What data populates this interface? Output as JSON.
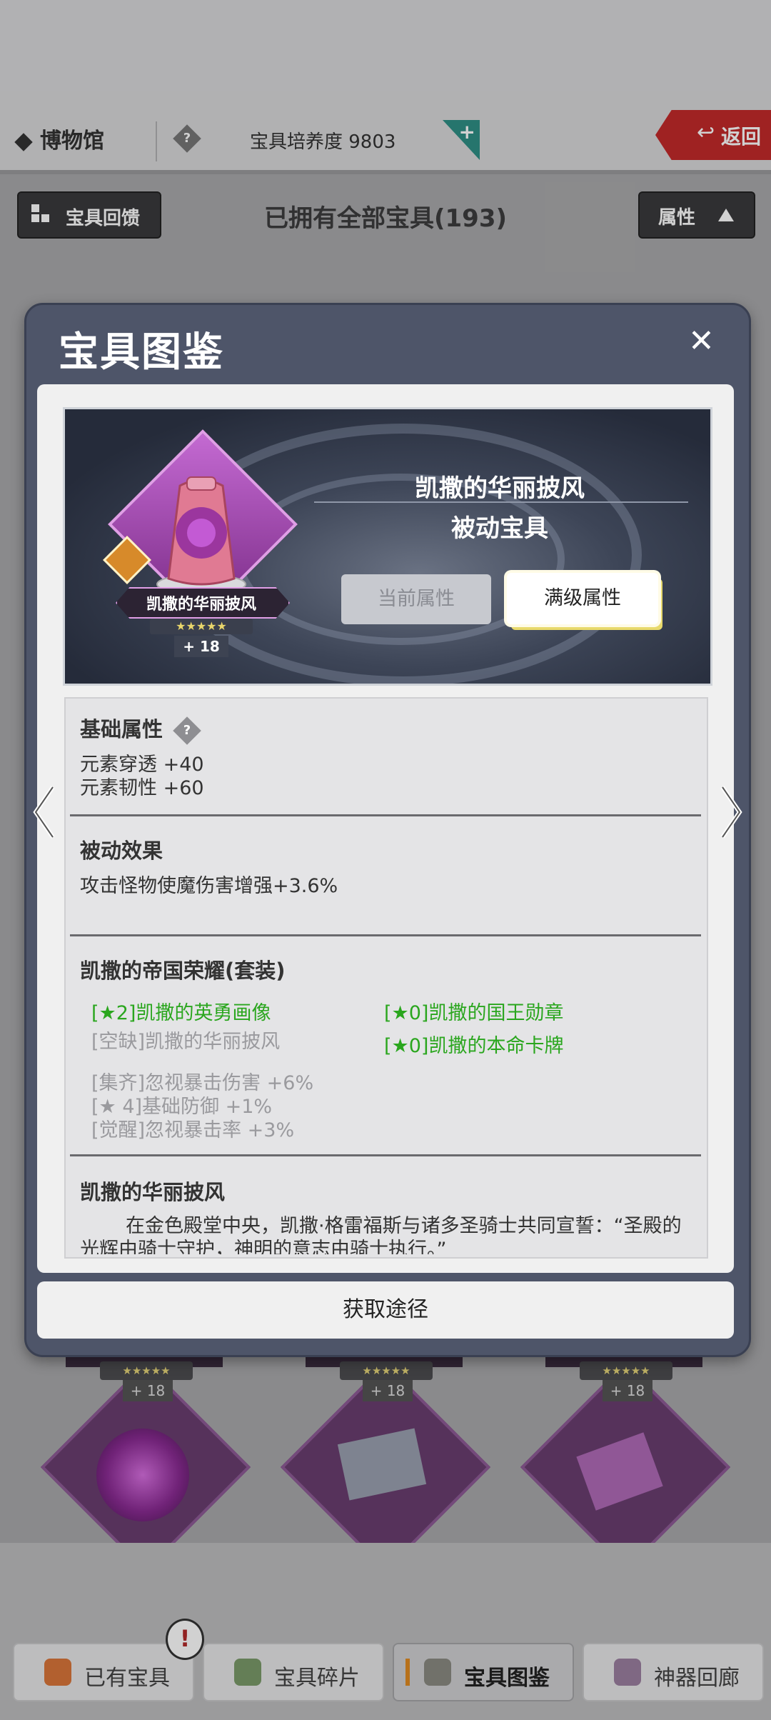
{
  "header": {
    "museum_title": "博物馆",
    "culture_label": "宝具培养度 9803",
    "help_icon_text": "?",
    "add_icon_text": "+",
    "back_label": "返回",
    "back_icon": "↩"
  },
  "toolbar": {
    "feedback_label": "宝具回馈",
    "owned_all_text": "已拥有全部宝具(193)",
    "attribute_label": "属性"
  },
  "background_items": {
    "stars": "★★★★★",
    "plus_level": "+ 18"
  },
  "modal": {
    "title": "宝具图鉴",
    "close_label": "✕",
    "item": {
      "badge_name": "凯撒的华丽披风",
      "stars": "★★★★★",
      "plus_level": "+ 18",
      "name": "凯撒的华丽披风",
      "type": "被动宝具"
    },
    "buttons": {
      "current_attr": "当前属性",
      "max_attr": "满级属性"
    },
    "base_attr": {
      "title": "基础属性",
      "help_text": "?",
      "lines": [
        "元素穿透 +40",
        "元素韧性 +60"
      ]
    },
    "passive": {
      "title": "被动效果",
      "text": "攻击怪物使魔伤害增强+3.6%"
    },
    "set": {
      "title": "凯撒的帝国荣耀(套装)",
      "pieces": [
        "[★2]凯撒的英勇画像",
        "[★0]凯撒的国王勋章",
        "[空缺]凯撒的华丽披风",
        "[★0]凯撒的本命卡牌"
      ],
      "bonuses": [
        "[集齐]忽视暴击伤害 +6%",
        "[★ 4]基础防御 +1%",
        "[觉醒]忽视暴击率 +3%"
      ]
    },
    "lore": {
      "title": "凯撒的华丽披风",
      "text": "在金色殿堂中央，凯撒·格雷福斯与诸多圣骑士共同宣誓：“圣殿的光辉由骑士守护，神明的意志由骑士执行。”"
    },
    "obtain_label": "获取途径"
  },
  "bottom_tabs": [
    {
      "label": "已有宝具"
    },
    {
      "label": "宝具碎片"
    },
    {
      "label": "宝具图鉴"
    },
    {
      "label": "神器回廊"
    }
  ],
  "alert_text": "!",
  "colors": {
    "accent_red": "#c32a2a",
    "set_owned_green": "#2aa61e",
    "modal_bg": "#4e5569",
    "tab_active_marker": "#e08a22"
  }
}
